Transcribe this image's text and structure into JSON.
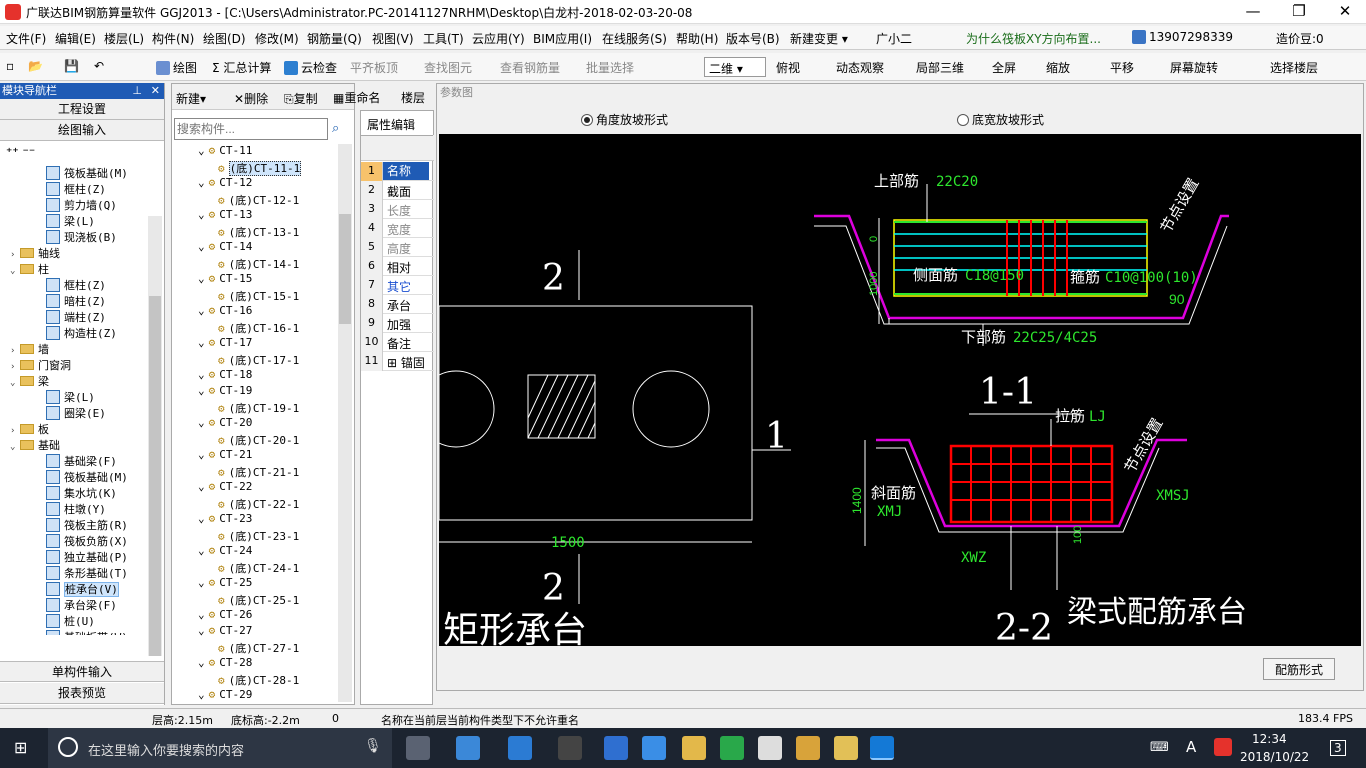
{
  "app": {
    "title": "广联达BIM钢筋算量软件 GGJ2013 - [C:\\Users\\Administrator.PC-20141127NRHM\\Desktop\\白龙村-2018-02-03-20-08",
    "window_controls": {
      "minimize": "—",
      "restore": "❐",
      "close": "✕"
    }
  },
  "menu": [
    "文件(F)",
    "编辑(E)",
    "楼层(L)",
    "构件(N)",
    "绘图(D)",
    "修改(M)",
    "钢筋量(Q)",
    "视图(V)",
    "工具(T)",
    "云应用(Y)",
    "BIM应用(I)",
    "在线服务(S)",
    "帮助(H)",
    "版本号(B)",
    "新建变更 ▾",
    "广小二"
  ],
  "menu_right": {
    "promo": "为什么筏板XY方向布置...",
    "phone": "13907298339",
    "points": "造价豆:0"
  },
  "toolbar": {
    "draw": "绘图",
    "sum": "Σ 汇总计算",
    "cloud_check": "云检查",
    "flat_top": "平齐板顶",
    "find": "查找图元",
    "view_rebar": "查看钢筋量",
    "batch_select": "批量选择",
    "view_mode": "二维",
    "top_view": "俯视",
    "dynamic": "动态观察",
    "local3d": "局部三维",
    "fullscreen": "全屏",
    "zoom": "缩放",
    "pan": "平移",
    "rotate": "屏幕旋转",
    "select_floor": "选择楼层"
  },
  "nav": {
    "header": "模块导航栏",
    "project_settings": "工程设置",
    "drawing_input": "绘图输入",
    "single_input": "单构件输入",
    "report_preview": "报表预览",
    "tree": [
      {
        "label": "筏板基础(M)",
        "level": 2,
        "type": "leaf"
      },
      {
        "label": "框柱(Z)",
        "level": 2,
        "type": "leaf"
      },
      {
        "label": "剪力墙(Q)",
        "level": 2,
        "type": "leaf"
      },
      {
        "label": "梁(L)",
        "level": 2,
        "type": "leaf"
      },
      {
        "label": "现浇板(B)",
        "level": 2,
        "type": "leaf"
      },
      {
        "label": "轴线",
        "level": 1,
        "type": "folder",
        "expanded": false
      },
      {
        "label": "柱",
        "level": 1,
        "type": "folder",
        "expanded": true
      },
      {
        "label": "框柱(Z)",
        "level": 2,
        "type": "leaf"
      },
      {
        "label": "暗柱(Z)",
        "level": 2,
        "type": "leaf"
      },
      {
        "label": "端柱(Z)",
        "level": 2,
        "type": "leaf"
      },
      {
        "label": "构造柱(Z)",
        "level": 2,
        "type": "leaf"
      },
      {
        "label": "墙",
        "level": 1,
        "type": "folder",
        "expanded": false
      },
      {
        "label": "门窗洞",
        "level": 1,
        "type": "folder",
        "expanded": false
      },
      {
        "label": "梁",
        "level": 1,
        "type": "folder",
        "expanded": true
      },
      {
        "label": "梁(L)",
        "level": 2,
        "type": "leaf"
      },
      {
        "label": "圈梁(E)",
        "level": 2,
        "type": "leaf"
      },
      {
        "label": "板",
        "level": 1,
        "type": "folder",
        "expanded": false
      },
      {
        "label": "基础",
        "level": 1,
        "type": "folder",
        "expanded": true
      },
      {
        "label": "基础梁(F)",
        "level": 2,
        "type": "leaf"
      },
      {
        "label": "筏板基础(M)",
        "level": 2,
        "type": "leaf"
      },
      {
        "label": "集水坑(K)",
        "level": 2,
        "type": "leaf"
      },
      {
        "label": "柱墩(Y)",
        "level": 2,
        "type": "leaf"
      },
      {
        "label": "筏板主筋(R)",
        "level": 2,
        "type": "leaf"
      },
      {
        "label": "筏板负筋(X)",
        "level": 2,
        "type": "leaf"
      },
      {
        "label": "独立基础(P)",
        "level": 2,
        "type": "leaf"
      },
      {
        "label": "条形基础(T)",
        "level": 2,
        "type": "leaf"
      },
      {
        "label": "桩承台(V)",
        "level": 2,
        "type": "leaf",
        "selected": true
      },
      {
        "label": "承台梁(F)",
        "level": 2,
        "type": "leaf"
      },
      {
        "label": "桩(U)",
        "level": 2,
        "type": "leaf"
      },
      {
        "label": "基础板带(W)",
        "level": 2,
        "type": "leaf"
      }
    ]
  },
  "components": {
    "new": "新建",
    "delete": "删除",
    "copy": "复制",
    "rename": "重命名",
    "floor": "楼层",
    "search_placeholder": "搜索构件...",
    "items": [
      {
        "label": "CT-11",
        "level": 0
      },
      {
        "label": "(底)CT-11-1",
        "level": 1,
        "selected": true
      },
      {
        "label": "CT-12",
        "level": 0
      },
      {
        "label": "(底)CT-12-1",
        "level": 1
      },
      {
        "label": "CT-13",
        "level": 0
      },
      {
        "label": "(底)CT-13-1",
        "level": 1
      },
      {
        "label": "CT-14",
        "level": 0
      },
      {
        "label": "(底)CT-14-1",
        "level": 1
      },
      {
        "label": "CT-15",
        "level": 0
      },
      {
        "label": "(底)CT-15-1",
        "level": 1
      },
      {
        "label": "CT-16",
        "level": 0
      },
      {
        "label": "(底)CT-16-1",
        "level": 1
      },
      {
        "label": "CT-17",
        "level": 0
      },
      {
        "label": "(底)CT-17-1",
        "level": 1
      },
      {
        "label": "CT-18",
        "level": 0
      },
      {
        "label": "CT-19",
        "level": 0
      },
      {
        "label": "(底)CT-19-1",
        "level": 1
      },
      {
        "label": "CT-20",
        "level": 0
      },
      {
        "label": "(底)CT-20-1",
        "level": 1
      },
      {
        "label": "CT-21",
        "level": 0
      },
      {
        "label": "(底)CT-21-1",
        "level": 1
      },
      {
        "label": "CT-22",
        "level": 0
      },
      {
        "label": "(底)CT-22-1",
        "level": 1
      },
      {
        "label": "CT-23",
        "level": 0
      },
      {
        "label": "(底)CT-23-1",
        "level": 1
      },
      {
        "label": "CT-24",
        "level": 0
      },
      {
        "label": "(底)CT-24-1",
        "level": 1
      },
      {
        "label": "CT-25",
        "level": 0
      },
      {
        "label": "(底)CT-25-1",
        "level": 1
      },
      {
        "label": "CT-26",
        "level": 0
      },
      {
        "label": "CT-27",
        "level": 0
      },
      {
        "label": "(底)CT-27-1",
        "level": 1
      },
      {
        "label": "CT-28",
        "level": 0
      },
      {
        "label": "(底)CT-28-1",
        "level": 1
      },
      {
        "label": "CT-29",
        "level": 0
      }
    ]
  },
  "properties": {
    "tab": "属性编辑",
    "rows": [
      {
        "n": "1",
        "name": "名称",
        "selected": true
      },
      {
        "n": "2",
        "name": "截面"
      },
      {
        "n": "3",
        "name": "长度",
        "gray": true
      },
      {
        "n": "4",
        "name": "宽度",
        "gray": true
      },
      {
        "n": "5",
        "name": "高度",
        "gray": true
      },
      {
        "n": "6",
        "name": "相对"
      },
      {
        "n": "7",
        "name": "其它",
        "blue": true
      },
      {
        "n": "8",
        "name": "承台"
      },
      {
        "n": "9",
        "name": "加强"
      },
      {
        "n": "10",
        "name": "备注"
      },
      {
        "n": "11",
        "name": "⊞ 锚固"
      }
    ]
  },
  "param": {
    "title": "参数图",
    "option_angle": "角度放坡形式",
    "option_width": "底宽放坡形式",
    "selected_option": "angle",
    "button": "配筋形式",
    "drawing": {
      "top_rebar": "上部筋",
      "top_rebar_val": "22C20",
      "side_rebar": "侧面筋",
      "side_rebar_val": "C18@150",
      "stirrup": "箍筋",
      "stirrup_val": "C10@100(10)",
      "bottom_rebar": "下部筋",
      "bottom_rebar_val": "22C25/4C25",
      "node_setting": "节点设置",
      "angle": "90",
      "section_1": "1-1",
      "tie": "拉筋",
      "tie_val": "LJ",
      "slope_rebar": "斜面筋",
      "slope_val": "XMJ",
      "xmsj": "XMSJ",
      "xwz": "XWZ",
      "height": "1400",
      "dim_0": "0",
      "dim_1000": "1000",
      "dim_100": "100",
      "width": "1500",
      "mark_2": "2",
      "mark_1": "1",
      "rect_title": "矩形承台",
      "section_2": "2-2",
      "beam_title": "梁式配筋承台"
    }
  },
  "status": {
    "floor_height": "层高:2.15m",
    "floor_bottom": "底标高:-2.2m",
    "zero": "0",
    "message": "名称在当前层当前构件类型下不允许重名",
    "fps": "183.4 FPS"
  },
  "taskbar": {
    "search_placeholder": "在这里输入你要搜索的内容",
    "time": "12:34",
    "date": "2018/10/22",
    "ime": "A",
    "notifications": "3"
  }
}
